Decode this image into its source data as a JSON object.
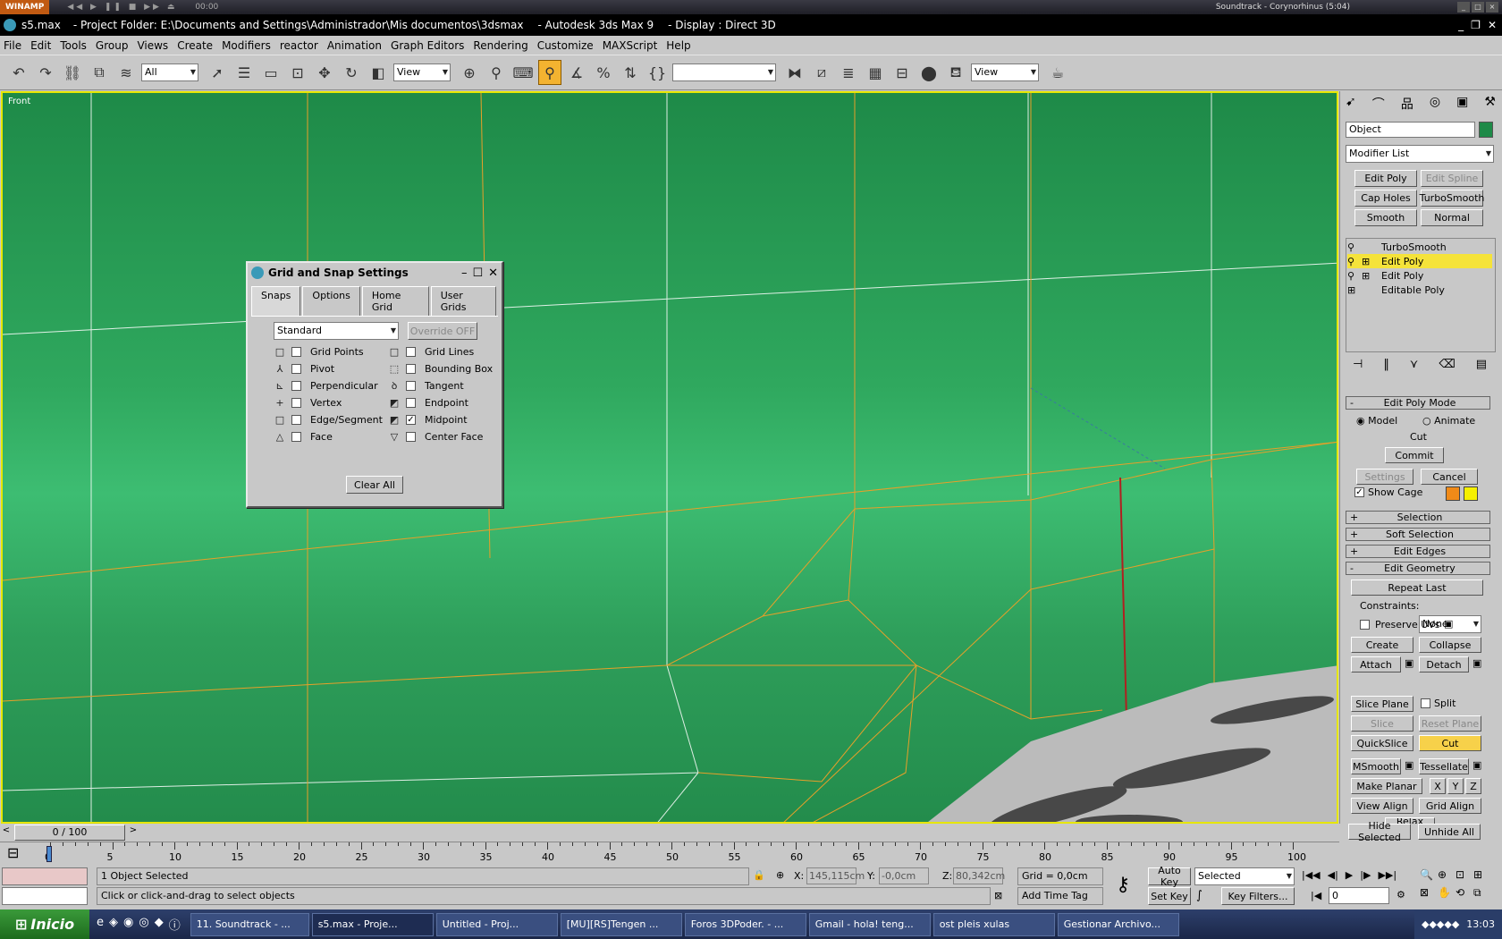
{
  "winamp": {
    "label": "WINAMP",
    "time": "00:00",
    "track": "Soundtrack - Corynorhinus (5:04)"
  },
  "title": {
    "file": "s5.max",
    "project": "- Project Folder: E:\\Documents and Settings\\Administrador\\Mis documentos\\3dsmax",
    "app": "- Autodesk 3ds Max 9",
    "display": "- Display : Direct 3D"
  },
  "menu": [
    "File",
    "Edit",
    "Tools",
    "Group",
    "Views",
    "Create",
    "Modifiers",
    "reactor",
    "Animation",
    "Graph Editors",
    "Rendering",
    "Customize",
    "MAXScript",
    "Help"
  ],
  "toolbar": {
    "filter": "All",
    "refcoord": "View",
    "refcoord2": "View"
  },
  "viewport": {
    "label": "Front"
  },
  "dialog": {
    "title": "Grid and Snap Settings",
    "tabs": [
      "Snaps",
      "Options",
      "Home Grid",
      "User Grids"
    ],
    "preset": "Standard",
    "override": "Override OFF",
    "left": [
      {
        "sym": "□",
        "label": "Grid Points",
        "checked": false
      },
      {
        "sym": "⅄",
        "label": "Pivot",
        "checked": false
      },
      {
        "sym": "⊾",
        "label": "Perpendicular",
        "checked": false
      },
      {
        "sym": "+",
        "label": "Vertex",
        "checked": false
      },
      {
        "sym": "□",
        "label": "Edge/Segment",
        "checked": false
      },
      {
        "sym": "△",
        "label": "Face",
        "checked": false
      }
    ],
    "right": [
      {
        "sym": "□",
        "label": "Grid Lines",
        "checked": false
      },
      {
        "sym": "⬚",
        "label": "Bounding Box",
        "checked": false
      },
      {
        "sym": "ꝺ",
        "label": "Tangent",
        "checked": false
      },
      {
        "sym": "◩",
        "label": "Endpoint",
        "checked": false
      },
      {
        "sym": "◩",
        "label": "Midpoint",
        "checked": true
      },
      {
        "sym": "▽",
        "label": "Center Face",
        "checked": false
      }
    ],
    "clear": "Clear All"
  },
  "cmd": {
    "object": "Object",
    "modlist": "Modifier List",
    "buttons": [
      [
        "Edit Poly",
        "Edit Spline"
      ],
      [
        "Cap Holes",
        "TurboSmooth"
      ],
      [
        "Smooth",
        "Normal"
      ]
    ],
    "stack": [
      {
        "label": "TurboSmooth",
        "hl": false
      },
      {
        "label": "Edit Poly",
        "hl": true
      },
      {
        "label": "Edit Poly",
        "hl": false
      },
      {
        "label": "Editable Poly",
        "hl": false
      }
    ],
    "editpolymode": "Edit Poly Mode",
    "model": "Model",
    "animate": "Animate",
    "cut": "Cut",
    "commit": "Commit",
    "settings": "Settings",
    "cancel": "Cancel",
    "showcage": "Show Cage",
    "rollouts": [
      "Selection",
      "Soft Selection",
      "Edit Edges",
      "Edit Geometry"
    ],
    "repeat": "Repeat Last",
    "constraints": "Constraints:",
    "none": "None",
    "preserve": "Preserve UVs",
    "geo": [
      [
        "Create",
        "Collapse"
      ],
      [
        "Attach",
        "Detach"
      ],
      [
        "Slice Plane",
        "Split"
      ],
      [
        "Slice",
        "Reset Plane"
      ],
      [
        "QuickSlice",
        "Cut"
      ],
      [
        "MSmooth",
        "Tessellate"
      ],
      [
        "Make Planar",
        "X",
        "Y",
        "Z"
      ],
      [
        "View Align",
        "Grid Align"
      ],
      [
        "Relax"
      ],
      [
        "Hide Selected",
        "Unhide All"
      ]
    ]
  },
  "timeline": {
    "frame": "0 / 100",
    "ticks": [
      "0",
      "5",
      "10",
      "15",
      "20",
      "25",
      "30",
      "35",
      "40",
      "45",
      "50",
      "55",
      "60",
      "65",
      "70",
      "75",
      "80",
      "85",
      "90",
      "95",
      "100"
    ]
  },
  "status": {
    "selected": "1 Object Selected",
    "prompt": "Click or click-and-drag to select objects",
    "x": "145,115cm",
    "y": "-0,0cm",
    "z": "80,342cm",
    "grid": "Grid = 0,0cm",
    "addtime": "Add Time Tag",
    "autokey": "Auto Key",
    "setkey": "Set Key",
    "selected_dd": "Selected",
    "keyfilters": "Key Filters...",
    "frame": "0"
  },
  "taskbar": {
    "start": "Inicio",
    "tasks": [
      "11. Soundtrack - ...",
      "s5.max - Proje...",
      "Untitled - Proj...",
      "[MU][RS]Tengen ...",
      "Foros 3DPoder. - ...",
      "Gmail - hola! teng...",
      "ost pleis xulas",
      "Gestionar Archivo..."
    ],
    "clock": "13:03"
  },
  "colors": {
    "viewport_border": "#e6e600",
    "highlight": "#f5e33a",
    "orange_edges": "#e7a029"
  }
}
